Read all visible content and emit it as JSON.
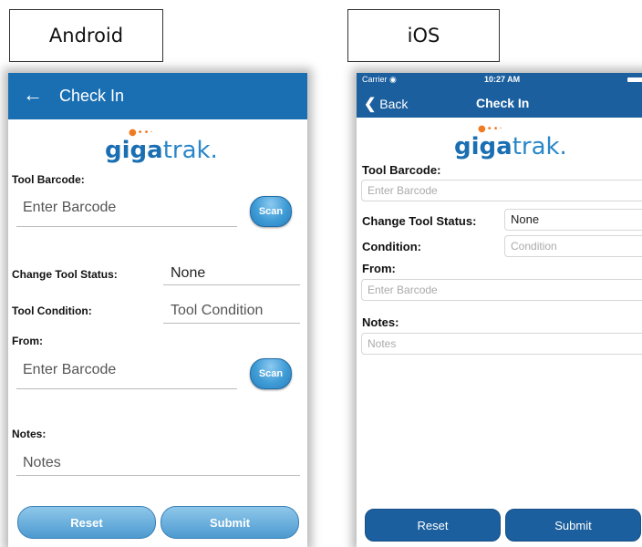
{
  "labels": {
    "android": "Android",
    "ios": "iOS"
  },
  "android": {
    "title": "Check In",
    "back_icon": "←",
    "logo": {
      "bold": "giga",
      "light": "trak.",
      "swoosh": "●••·"
    },
    "tool_barcode_label": "Tool Barcode:",
    "tool_barcode_placeholder": "Enter Barcode",
    "scan_label": "Scan",
    "change_status_label": "Change Tool Status:",
    "change_status_value": "None",
    "tool_condition_label": "Tool Condition:",
    "tool_condition_placeholder": "Tool Condition",
    "from_label": "From:",
    "from_placeholder": "Enter Barcode",
    "notes_label": "Notes:",
    "notes_placeholder": "Notes",
    "reset_label": "Reset",
    "submit_label": "Submit"
  },
  "ios": {
    "carrier": "Carrier ◉",
    "time": "10:27 AM",
    "back_label": "Back",
    "title": "Check In",
    "logo": {
      "bold": "giga",
      "light": "trak.",
      "swoosh": "●••·"
    },
    "tool_barcode_label": "Tool Barcode:",
    "tool_barcode_placeholder": "Enter Barcode",
    "change_status_label": "Change Tool Status:",
    "change_status_value": "None",
    "condition_label": "Condition:",
    "condition_placeholder": "Condition",
    "from_label": "From:",
    "from_placeholder": "Enter Barcode",
    "notes_label": "Notes:",
    "notes_placeholder": "Notes",
    "reset_label": "Reset",
    "submit_label": "Submit"
  },
  "colors": {
    "android_bar": "#1a6fb3",
    "ios_bar": "#1b5f9e",
    "logo_accent": "#f07a22"
  }
}
